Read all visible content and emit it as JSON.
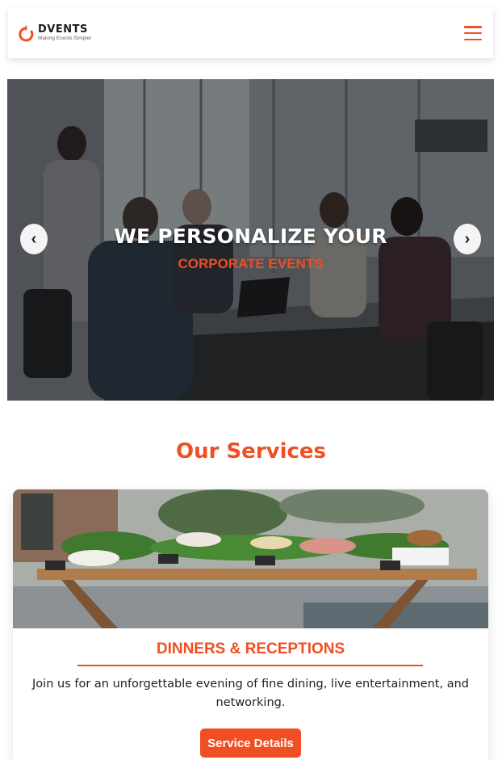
{
  "header": {
    "brand_name": "DVENTS",
    "brand_tagline": "Making Events Simpler",
    "logo_icon": "flame-ring-icon",
    "menu_icon": "hamburger-menu-icon"
  },
  "hero": {
    "title": "WE PERSONALIZE YOUR",
    "subtitle": "CORPORATE EVENTS",
    "prev_symbol": "‹",
    "next_symbol": "›"
  },
  "services": {
    "heading": "Our Services",
    "card": {
      "title": "DINNERS & RECEPTIONS",
      "description": "Join us for an unforgettable evening of fine dining, live entertainment, and networking.",
      "button_label": "Service Details"
    }
  },
  "colors": {
    "accent": "#f04e23",
    "text": "#222222",
    "white": "#ffffff"
  }
}
